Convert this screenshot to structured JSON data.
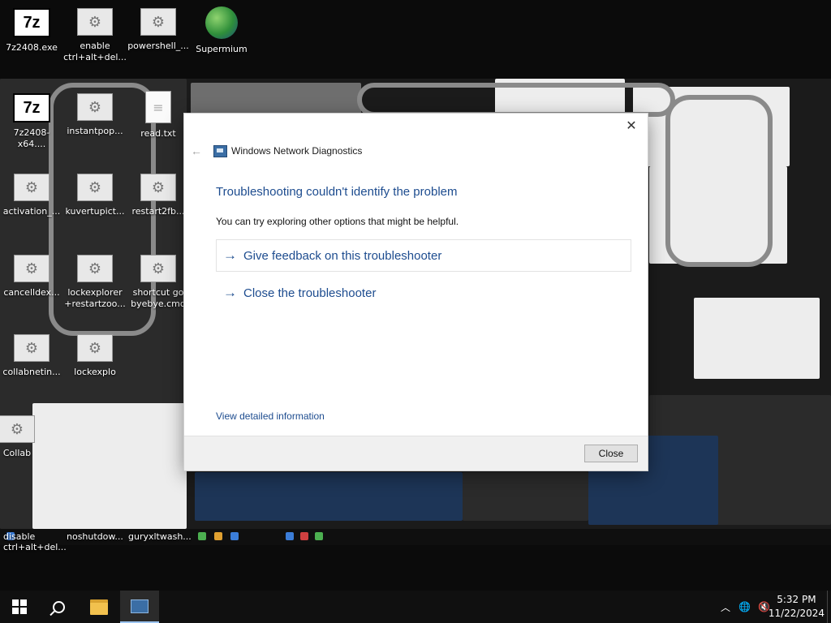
{
  "desktop_top_icons": [
    {
      "label": "7z2408.exe",
      "icon": "7z-icon"
    },
    {
      "label": "enable ctrl+alt+del...",
      "icon": "gear-icon"
    },
    {
      "label": "powershell_...",
      "icon": "gear-icon"
    },
    {
      "label": "Supermium",
      "icon": "globe-icon"
    }
  ],
  "desktop_inner_icons": [
    {
      "label": "7z2408-x64....",
      "icon": "7z-icon"
    },
    {
      "label": "instantpop...",
      "icon": "gear-icon"
    },
    {
      "label": "read.txt",
      "icon": "doc-icon"
    },
    {
      "label": "activation_...",
      "icon": "gear-icon"
    },
    {
      "label": "kuvertupict...",
      "icon": "gear-icon"
    },
    {
      "label": "restart2fb...",
      "icon": "gear-icon"
    },
    {
      "label": "cancelldex...",
      "icon": "gear-icon"
    },
    {
      "label": "lockexplorer +restartzoo...",
      "icon": "gear-icon"
    },
    {
      "label": "shortcut go byebye.cmd",
      "icon": "gear-icon"
    },
    {
      "label": "collabnetin...",
      "icon": "gear-icon"
    },
    {
      "label": "lockexplo",
      "icon": "gear-icon"
    },
    {
      "label": "Collab",
      "icon": "gear-icon"
    }
  ],
  "dialog": {
    "title": "Windows Network Diagnostics",
    "heading": "Troubleshooting couldn't identify the problem",
    "subtext": "You can try exploring other options that might be helpful.",
    "options": [
      {
        "label": "Give feedback on this troubleshooter"
      },
      {
        "label": "Close the troubleshooter"
      }
    ],
    "details_link": "View detailed information",
    "close_button": "Close"
  },
  "inner_taskbar": {
    "labels": [
      "disable ctrl+alt+del...",
      "noshutdow...",
      "guryxltwash..."
    ]
  },
  "taskbar": {
    "time": "5:32 PM",
    "date": "11/22/2024"
  },
  "colors": {
    "link_blue": "#1d4c8f",
    "taskbar_bg": "#101010",
    "dialog_footer": "#f0f0f0"
  }
}
